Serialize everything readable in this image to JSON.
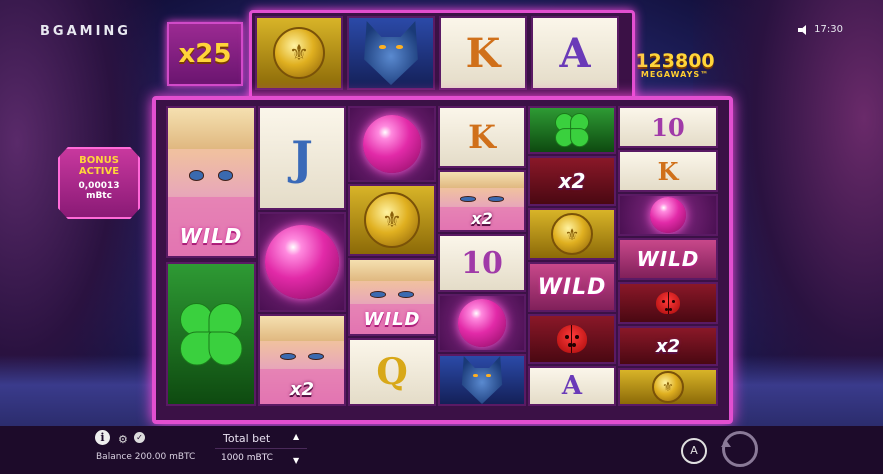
{
  "brand": {
    "logo": "BGAMING"
  },
  "status": {
    "time": "17:30",
    "sound_icon": "speaker-icon"
  },
  "multiplier": {
    "label": "x25"
  },
  "megaways": {
    "count": "123800",
    "label": "MEGAWAYS™"
  },
  "bonus": {
    "title": "BONUS ACTIVE",
    "value": "0,00013",
    "unit": "mBtc"
  },
  "top_reel": [
    {
      "symbol": "coin"
    },
    {
      "symbol": "wolf"
    },
    {
      "symbol": "K"
    },
    {
      "symbol": "A"
    }
  ],
  "reels": [
    [
      {
        "symbol": "girl-wild",
        "label": "WILD"
      },
      {
        "symbol": "clover"
      }
    ],
    [
      {
        "symbol": "J"
      },
      {
        "symbol": "orb"
      },
      {
        "symbol": "girl-x2",
        "label": "x2"
      }
    ],
    [
      {
        "symbol": "orb"
      },
      {
        "symbol": "coin"
      },
      {
        "symbol": "girl-wild",
        "label": "WILD"
      },
      {
        "symbol": "Q"
      }
    ],
    [
      {
        "symbol": "K"
      },
      {
        "symbol": "girl-x2",
        "label": "x2"
      },
      {
        "symbol": "10"
      },
      {
        "symbol": "orb"
      },
      {
        "symbol": "wolf"
      }
    ],
    [
      {
        "symbol": "clover"
      },
      {
        "symbol": "x2",
        "label": "x2"
      },
      {
        "symbol": "coin"
      },
      {
        "symbol": "wild",
        "label": "WILD"
      },
      {
        "symbol": "ladybug"
      },
      {
        "symbol": "A"
      }
    ],
    [
      {
        "symbol": "10"
      },
      {
        "symbol": "K"
      },
      {
        "symbol": "orb"
      },
      {
        "symbol": "wild",
        "label": "WILD"
      },
      {
        "symbol": "ladybug"
      },
      {
        "symbol": "x2",
        "label": "x2"
      },
      {
        "symbol": "coin"
      }
    ]
  ],
  "bottom": {
    "balance": "Balance 200.00 mBTC",
    "total_bet_label": "Total bet",
    "total_bet_value": "1000 mBTC",
    "autoplay_label": "A"
  },
  "letters": {
    "J": "J",
    "K": "K",
    "A": "A",
    "Q": "Q",
    "ten": "10"
  }
}
